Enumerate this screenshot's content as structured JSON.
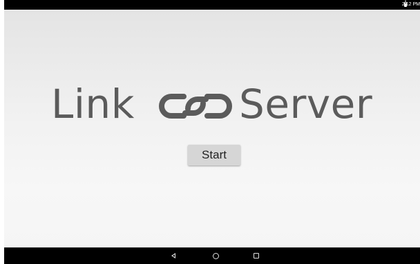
{
  "status_bar": {
    "time": "2:12 PM",
    "battery_icon": "battery-icon"
  },
  "app": {
    "logo_word_left": "Link",
    "logo_icon": "chain-link-icon",
    "logo_word_right": "Server",
    "start_label": "Start",
    "logo_color": "#5b5b5b"
  },
  "nav_bar": {
    "back_icon": "back-triangle-icon",
    "home_icon": "home-circle-icon",
    "recents_icon": "recents-square-icon"
  }
}
